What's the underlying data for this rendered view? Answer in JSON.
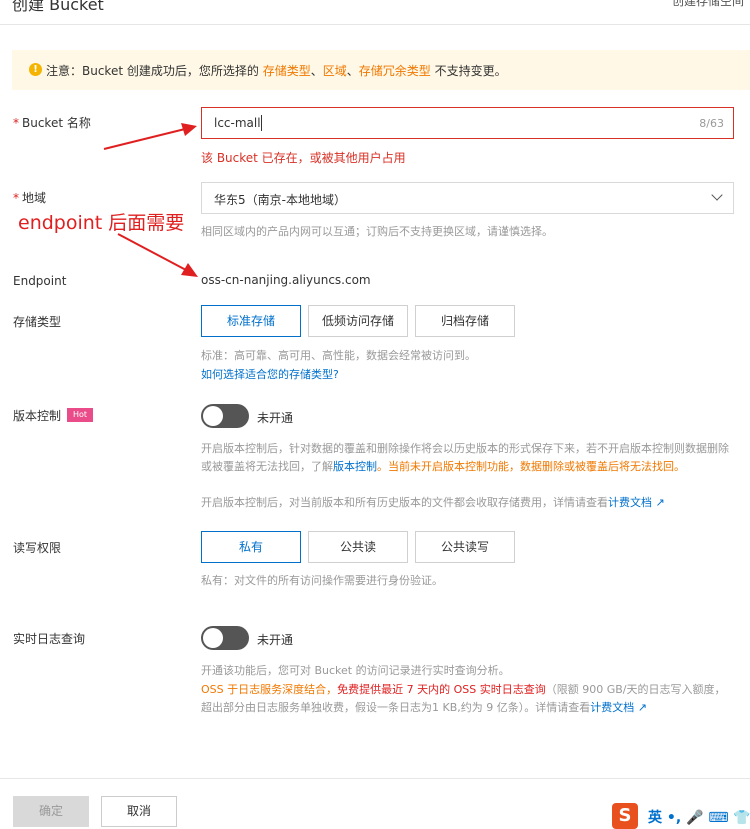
{
  "header": {
    "title": "创建 Bucket",
    "right_link": "创建存储空间"
  },
  "notice": {
    "prefix": "注意：Bucket 创建成功后，您所选择的",
    "link1": "存储类型",
    "sep1": "、",
    "link2": "区域",
    "sep2": "、",
    "link3": "存储冗余类型",
    "suffix": "不支持变更。"
  },
  "bucket": {
    "label": "Bucket 名称",
    "value": "lcc-mall",
    "counter": "8/63",
    "error": "该 Bucket 已存在，或被其他用户占用"
  },
  "region": {
    "label": "地域",
    "value": "华东5（南京-本地地域）",
    "help": "相同区域内的产品内网可以互通；订购后不支持更换区域，请谨慎选择。"
  },
  "annotation": "endpoint 后面需要",
  "endpoint": {
    "label": "Endpoint",
    "value": "oss-cn-nanjing.aliyuncs.com"
  },
  "storage_class": {
    "label": "存储类型",
    "options": [
      "标准存储",
      "低频访问存储",
      "归档存储"
    ],
    "help": "标准：高可靠、高可用、高性能，数据会经常被访问到。",
    "link": "如何选择适合您的存储类型?"
  },
  "versioning": {
    "label": "版本控制",
    "badge": "Hot",
    "state": "未开通",
    "help1": "开启版本控制后，针对数据的覆盖和删除操作将会以历史版本的形式保存下来，若不开启版本控制则数据删除或被覆盖将无法找回，了解",
    "help1_link": "版本控制",
    "help1_warn": "。当前未开启版本控制功能，数据删除或被覆盖后将无法找回。",
    "help2": "开启版本控制后，对当前版本和所有历史版本的文件都会收取存储费用，详情请查看",
    "help2_link": "计费文档"
  },
  "acl": {
    "label": "读写权限",
    "options": [
      "私有",
      "公共读",
      "公共读写"
    ],
    "help": "私有：对文件的所有访问操作需要进行身份验证。"
  },
  "logging": {
    "label": "实时日志查询",
    "state": "未开通",
    "help1": "开通该功能后，您可对 Bucket 的访问记录进行实时查询分析。",
    "help2_a": "OSS 于日志服务深度结合，",
    "help2_b": "免费提供最近 7 天内的 OSS 实时日志查询",
    "help2_c": "（限额 900 GB/天的日志写入额度，超出部分由日志服务单独收费，假设一条日志为1 KB,约为 9 亿条）。详情请查看",
    "help2_link": "计费文档"
  },
  "footer": {
    "ok": "确定",
    "cancel": "取消"
  },
  "ime": {
    "logo": "S",
    "text": "英 •, 🎤 ⌨ 👕 ⋯"
  }
}
